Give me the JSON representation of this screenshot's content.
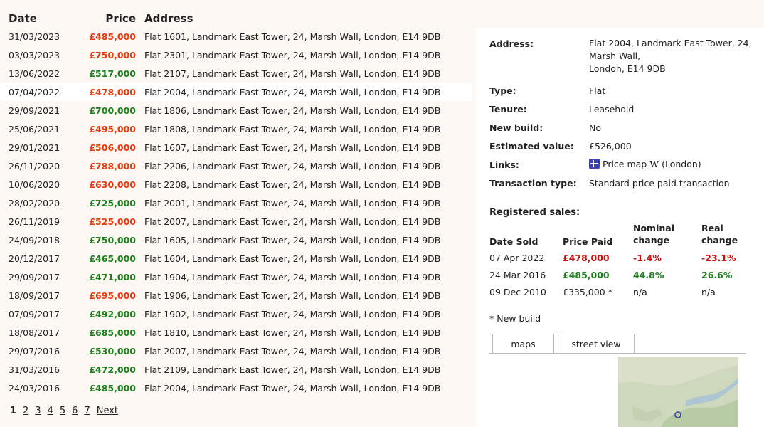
{
  "sales_table": {
    "headers": {
      "date": "Date",
      "price": "Price",
      "address": "Address"
    },
    "rows": [
      {
        "date": "31/03/2023",
        "price": "£485,000",
        "trend": "down",
        "address": "Flat 1601, Landmark East Tower, 24, Marsh Wall, London, E14 9DB"
      },
      {
        "date": "03/03/2023",
        "price": "£750,000",
        "trend": "down",
        "address": "Flat 2301, Landmark East Tower, 24, Marsh Wall, London, E14 9DB"
      },
      {
        "date": "13/06/2022",
        "price": "£517,000",
        "trend": "up",
        "address": "Flat 2107, Landmark East Tower, 24, Marsh Wall, London, E14 9DB"
      },
      {
        "date": "07/04/2022",
        "price": "£478,000",
        "trend": "down",
        "address": "Flat 2004, Landmark East Tower, 24, Marsh Wall, London, E14 9DB",
        "selected": true
      },
      {
        "date": "29/09/2021",
        "price": "£700,000",
        "trend": "up",
        "address": "Flat 1806, Landmark East Tower, 24, Marsh Wall, London, E14 9DB"
      },
      {
        "date": "25/06/2021",
        "price": "£495,000",
        "trend": "down",
        "address": "Flat 1808, Landmark East Tower, 24, Marsh Wall, London, E14 9DB"
      },
      {
        "date": "29/01/2021",
        "price": "£506,000",
        "trend": "down",
        "address": "Flat 1607, Landmark East Tower, 24, Marsh Wall, London, E14 9DB"
      },
      {
        "date": "26/11/2020",
        "price": "£788,000",
        "trend": "down",
        "address": "Flat 2206, Landmark East Tower, 24, Marsh Wall, London, E14 9DB"
      },
      {
        "date": "10/06/2020",
        "price": "£630,000",
        "trend": "down",
        "address": "Flat 2208, Landmark East Tower, 24, Marsh Wall, London, E14 9DB"
      },
      {
        "date": "28/02/2020",
        "price": "£725,000",
        "trend": "up",
        "address": "Flat 2001, Landmark East Tower, 24, Marsh Wall, London, E14 9DB"
      },
      {
        "date": "26/11/2019",
        "price": "£525,000",
        "trend": "down",
        "address": "Flat 2007, Landmark East Tower, 24, Marsh Wall, London, E14 9DB"
      },
      {
        "date": "24/09/2018",
        "price": "£750,000",
        "trend": "up",
        "address": "Flat 1605, Landmark East Tower, 24, Marsh Wall, London, E14 9DB"
      },
      {
        "date": "20/12/2017",
        "price": "£465,000",
        "trend": "up",
        "address": "Flat 1604, Landmark East Tower, 24, Marsh Wall, London, E14 9DB"
      },
      {
        "date": "29/09/2017",
        "price": "£471,000",
        "trend": "up",
        "address": "Flat 1904, Landmark East Tower, 24, Marsh Wall, London, E14 9DB"
      },
      {
        "date": "18/09/2017",
        "price": "£695,000",
        "trend": "down",
        "address": "Flat 1906, Landmark East Tower, 24, Marsh Wall, London, E14 9DB"
      },
      {
        "date": "07/09/2017",
        "price": "£492,000",
        "trend": "up",
        "address": "Flat 1902, Landmark East Tower, 24, Marsh Wall, London, E14 9DB"
      },
      {
        "date": "18/08/2017",
        "price": "£685,000",
        "trend": "up",
        "address": "Flat 1810, Landmark East Tower, 24, Marsh Wall, London, E14 9DB"
      },
      {
        "date": "29/07/2016",
        "price": "£530,000",
        "trend": "up",
        "address": "Flat 2007, Landmark East Tower, 24, Marsh Wall, London, E14 9DB"
      },
      {
        "date": "31/03/2016",
        "price": "£472,000",
        "trend": "up",
        "address": "Flat 2109, Landmark East Tower, 24, Marsh Wall, London, E14 9DB"
      },
      {
        "date": "24/03/2016",
        "price": "£485,000",
        "trend": "up",
        "address": "Flat 2004, Landmark East Tower, 24, Marsh Wall, London, E14 9DB"
      }
    ]
  },
  "pagination": {
    "pages": [
      "1",
      "2",
      "3",
      "4",
      "5",
      "6",
      "7"
    ],
    "current": "1",
    "next_label": "Next"
  },
  "details": {
    "address_label": "Address:",
    "address_lines": [
      "Flat 2004, Landmark East Tower, 24,",
      "Marsh Wall,",
      "London, E14 9DB"
    ],
    "type_label": "Type:",
    "type_value": "Flat",
    "tenure_label": "Tenure:",
    "tenure_value": "Leasehold",
    "newbuild_label": "New build:",
    "newbuild_value": "No",
    "estimated_label": "Estimated value:",
    "estimated_value": "£526,000",
    "links_label": "Links:",
    "links_price_map": "Price map",
    "links_wiki_glyph": "W",
    "links_wiki_text": "(London)",
    "transaction_label": "Transaction type:",
    "transaction_value": "Standard price paid transaction"
  },
  "registered_sales": {
    "title": "Registered sales:",
    "headers": {
      "date": "Date Sold",
      "price": "Price Paid",
      "nominal_1": "Nominal",
      "nominal_2": "change",
      "real_1": "Real",
      "real_2": "change"
    },
    "rows": [
      {
        "date": "07 Apr 2022",
        "price": "£478,000",
        "nominal": "-1.4%",
        "real": "-23.1%",
        "tone": "red"
      },
      {
        "date": "24 Mar 2016",
        "price": "£485,000",
        "nominal": "44.8%",
        "real": "26.6%",
        "tone": "green"
      },
      {
        "date": "09 Dec 2010",
        "price": "£335,000 *",
        "nominal": "n/a",
        "real": "n/a",
        "tone": "plain"
      }
    ],
    "footnote": "* New build"
  },
  "map_tabs": {
    "maps": "maps",
    "street_view": "street view"
  },
  "colors": {
    "price_up": "#1b7f1b",
    "price_down": "#e8380d",
    "change_negative": "#cc1010",
    "change_positive": "#1b7f1b",
    "page_bg": "#fdf8f4"
  }
}
